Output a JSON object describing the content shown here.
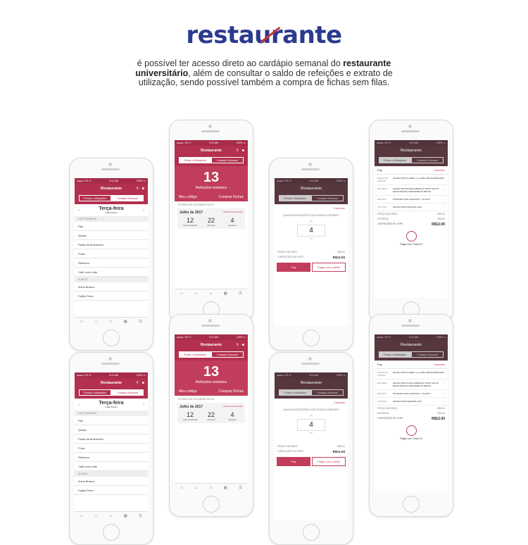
{
  "logo": {
    "prefix": "resta",
    "struck": "u",
    "suffix": "rante"
  },
  "intro": {
    "p1": "é possível ter acesso direto ao cardápio semanal do ",
    "bold": "restaurante universitário",
    "p2": ", além de consultar o saldo de refeições e extrato de utilização, sendo possível também a compra de fichas sem filas."
  },
  "app": {
    "title": "Restaurante",
    "tabs": [
      "Fichas e Utilizações",
      "Cardápio Semanal"
    ],
    "carrier": "●●●●○ OS ✦",
    "time": "9:41 AM",
    "battery": "100% ▭",
    "search_icon": "⚲",
    "avatar_icon": "☻"
  },
  "menu": {
    "day": "Terça-feira",
    "date": "6 DE JULHO",
    "sections": [
      {
        "name": "CAFÉ DA MANHÃ",
        "items": [
          "Pão",
          "Queijo",
          "Pasta de Amendoim",
          "Fruta",
          "Refresco",
          "Café com Leite"
        ]
      },
      {
        "name": "ALMOÇO",
        "items": [
          "Arroz Branco",
          "Feijão Preto"
        ]
      }
    ]
  },
  "balance": {
    "count": "13",
    "label": "Refeições restantes",
    "my_code": "Meu código",
    "buy": "Comprar Fichas",
    "extract_title": "EXTRATO DE UTILIZAÇÃO DO RU",
    "month": "Julho de 2017",
    "download": "BAIXAR DETALHES",
    "days": [
      {
        "n": "12",
        "label": "Café da Manhã"
      },
      {
        "n": "22",
        "label": "Almoços"
      },
      {
        "n": "4",
        "label": "Jantares"
      }
    ]
  },
  "purchase": {
    "cancel": "Cancelar",
    "question": "QUANTAS REFEIÇÕES VOCÊ DESEJA COMPRAR?",
    "qty": "4",
    "unit_label": "PREÇO UNITÁRIO",
    "unit_price": "R$3.00",
    "total_label": "4 REFEIÇÕES RU UFPE",
    "total": "R$12.00",
    "apple_pay": " Pay",
    "card_pay": "Pagar com cartão"
  },
  "applepay": {
    "brand": " Pay",
    "cancel": "Cancelar",
    "rows": [
      {
        "k": "DADOS DO CARTÃO",
        "v": "FELIPE SANTOS DEBIT (•••• 2345) 3084 MATERCARD"
      },
      {
        "k": "ENTREGA",
        "v": "FELIPE SANTOS DE ALMEIDA AV. PROF SOUTO MAIOR RECIFE, PERNAMBUCO BRASIL"
      },
      {
        "k": "MÉTODO",
        "v": "STANDART (DHL EUROPE) 5 - 10 DAYS"
      },
      {
        "k": "CONTATO",
        "v": "FELIPE.SANTOS@UFPE.COM"
      }
    ],
    "sub": [
      {
        "k": "PREÇO UNITÁRIO",
        "v": "R$3.00"
      },
      {
        "k": "ENTREGA",
        "v": "R$0.00"
      }
    ],
    "total_label": "4 REFEIÇÕES RU UFPE",
    "total": "R$12.00",
    "touch": "Pagar com Touch ID"
  },
  "tabbar_icons": [
    "⌂",
    "♨",
    "⌂",
    "▦",
    "⚿"
  ]
}
